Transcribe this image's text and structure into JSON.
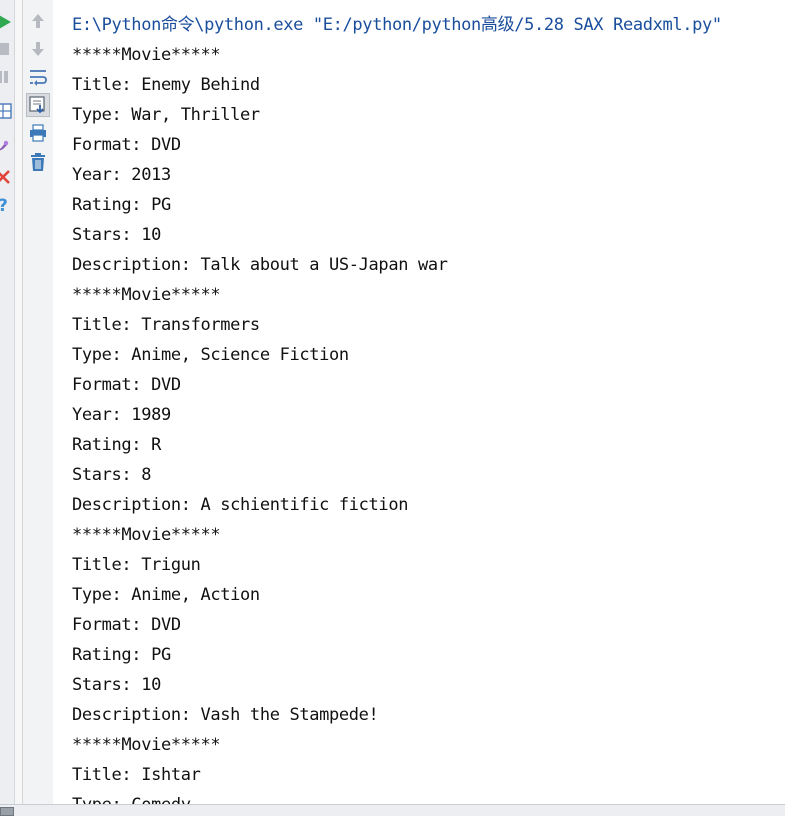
{
  "console": {
    "command": "E:\\Python命令\\python.exe \"E:/python/python高级/5.28 SAX Readxml.py\"",
    "lines": [
      "*****Movie*****",
      "Title: Enemy Behind",
      "Type: War, Thriller",
      "Format: DVD",
      "Year: 2013",
      "Rating: PG",
      "Stars: 10",
      "Description: Talk about a US-Japan war",
      "*****Movie*****",
      "Title: Transformers",
      "Type: Anime, Science Fiction",
      "Format: DVD",
      "Year: 1989",
      "Rating: R",
      "Stars: 8",
      "Description: A schientific fiction",
      "*****Movie*****",
      "Title: Trigun",
      "Type: Anime, Action",
      "Format: DVD",
      "Rating: PG",
      "Stars: 10",
      "Description: Vash the Stampede!",
      "*****Movie*****",
      "Title: Ishtar",
      "Type: Comedy"
    ]
  },
  "run_toolbar": {
    "icons": [
      "run-icon",
      "stop-icon",
      "pause-icon",
      "layout-icon",
      "pin-icon",
      "close-icon",
      "help-icon"
    ],
    "colors": {
      "run": "#2fa84f",
      "close": "#e0443a",
      "help": "#3d8fd6"
    }
  },
  "console_toolbar": {
    "icons": [
      "up-arrow-icon",
      "down-arrow-icon",
      "soft-wrap-icon",
      "scroll-to-end-icon",
      "print-icon",
      "trash-icon"
    ]
  }
}
